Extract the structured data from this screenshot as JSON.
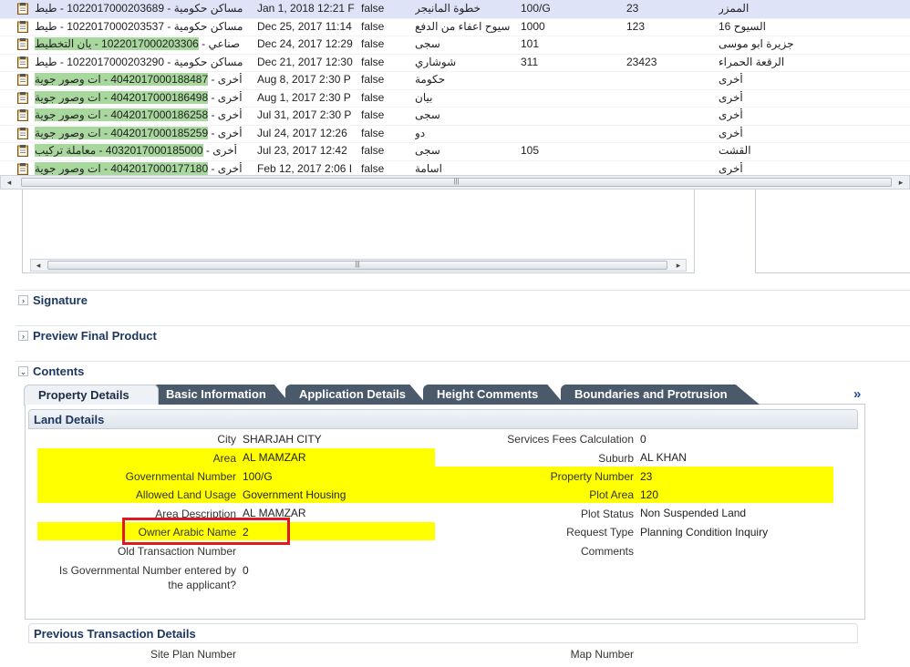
{
  "table": {
    "rows": [
      {
        "prefix": "",
        "number": "1022017000203689",
        "arabic": "مساكن حكومية",
        "extra": "طيط",
        "date": "Jan 1, 2018 12:21 F",
        "flag": "false",
        "desc": "خطوة المانيجر",
        "gov": "100/G",
        "prop": "23",
        "area": "الممزر"
      },
      {
        "prefix": "",
        "number": "1022017000203537",
        "arabic": "مساكن حكومية",
        "extra": "طيط",
        "date": "Dec 25, 2017 11:14",
        "flag": "false",
        "desc": "سيوح اعفاء من الدفع",
        "gov": "1000",
        "prop": "123",
        "area": "السيوح 16"
      },
      {
        "prefix": "صناعي",
        "number": "1022017000203306",
        "arabic": "",
        "extra": "يان التخطيط",
        "date": "Dec 24, 2017 12:29",
        "flag": "false",
        "desc": "سجى",
        "gov": "101",
        "prop": "",
        "area": "جزيرة ابو موسى"
      },
      {
        "prefix": "",
        "number": "1022017000203290",
        "arabic": "مساكن حكومية",
        "extra": "طيط",
        "date": "Dec 21, 2017 12:30",
        "flag": "false",
        "desc": "شوشاري",
        "gov": "311",
        "prop": "23423",
        "area": "الرقعة الحمراء"
      },
      {
        "prefix": "أخرى",
        "number": "4042017000188487",
        "arabic": "",
        "extra": "ات وصور جوية",
        "date": "Aug 8, 2017 2:30 P",
        "flag": "false",
        "desc": "حكومة",
        "gov": "",
        "prop": "",
        "area": "أخرى"
      },
      {
        "prefix": "أخرى",
        "number": "4042017000186498",
        "arabic": "",
        "extra": "ات وصور جوية",
        "date": "Aug 1, 2017 2:30 P",
        "flag": "false",
        "desc": "بيان",
        "gov": "",
        "prop": "",
        "area": "أخرى"
      },
      {
        "prefix": "أخرى",
        "number": "4042017000186258",
        "arabic": "",
        "extra": "ات وصور جوية",
        "date": "Jul 31, 2017 2:30 P",
        "flag": "false",
        "desc": "سجى",
        "gov": "",
        "prop": "",
        "area": "أخرى"
      },
      {
        "prefix": "أخرى",
        "number": "4042017000185259",
        "arabic": "",
        "extra": "ات وصور جوية",
        "date": "Jul 24, 2017 12:26",
        "flag": "false",
        "desc": "دو",
        "gov": "",
        "prop": "",
        "area": "أخرى"
      },
      {
        "prefix": "أخرى",
        "number": "4032017000185000",
        "arabic": "",
        "extra": "معاملة تركيب",
        "date": "Jul 23, 2017 12:42",
        "flag": "false",
        "desc": "سجى",
        "gov": "105",
        "prop": "",
        "area": "القشت"
      },
      {
        "prefix": "أخرى",
        "number": "4042017000177180",
        "arabic": "",
        "extra": "ات وصور جوية",
        "date": "Feb 12, 2017 2:06 I",
        "flag": "false",
        "desc": "اسامة",
        "gov": "",
        "prop": "",
        "area": "أخرى"
      }
    ]
  },
  "sections": {
    "signature": "Signature",
    "preview": "Preview Final Product",
    "contents": "Contents"
  },
  "tabs": [
    "Property Details",
    "Basic Information",
    "Application Details",
    "Height Comments",
    "Boundaries and Protrusion"
  ],
  "tabs_overflow": "»",
  "land_details": {
    "header": "Land Details",
    "left": [
      {
        "label": "City",
        "value": "SHARJAH CITY"
      },
      {
        "label": "Area",
        "value": "AL MAMZAR"
      },
      {
        "label": "Governmental Number",
        "value": "100/G"
      },
      {
        "label": "Allowed Land Usage",
        "value": "Government Housing"
      },
      {
        "label": "Area Description",
        "value": "AL MAMZAR"
      },
      {
        "label": "Owner Arabic Name",
        "value": "2"
      },
      {
        "label": "Old Transaction Number",
        "value": ""
      },
      {
        "label": "Is Governmental Number entered by",
        "label2": "the applicant?",
        "value": "0"
      }
    ],
    "right": [
      {
        "label": "Services Fees Calculation",
        "value": "0"
      },
      {
        "label": "Suburb",
        "value": "AL KHAN"
      },
      {
        "label": "Property Number",
        "value": "23"
      },
      {
        "label": "Plot Area",
        "value": "120"
      },
      {
        "label": "Plot Status",
        "value": "Non Suspended Land"
      },
      {
        "label": "Request Type",
        "value": "Planning Condition Inquiry"
      },
      {
        "label": "Comments",
        "value": ""
      }
    ]
  },
  "previous": {
    "header": "Previous Transaction Details",
    "site_plan_label": "Site Plan Number",
    "map_label": "Map Number"
  },
  "colors": {
    "highlight": "#ffff00",
    "green_highlight": "#a9d89f",
    "annotation_box": "#e0191e",
    "selected_row": "#dfe3f7"
  }
}
